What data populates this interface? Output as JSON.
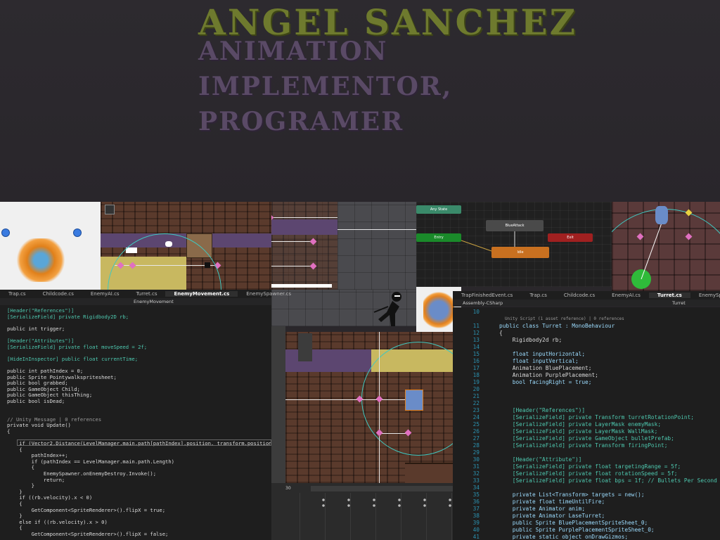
{
  "header": {
    "name": "ANGEL SANCHEZ",
    "role_line1": "ANIMATION",
    "role_line2": "IMPLEMENTOR,",
    "role_line3": "PROGRAMER"
  },
  "left_editor": {
    "tabs": [
      "Trap.cs",
      "Childcode.cs",
      "EnemyAI.cs",
      "Turret.cs",
      "EnemyMovement.cs",
      "EnemySpawner.cs"
    ],
    "active_tab": "EnemyMovement.cs",
    "breadcrumb": "EnemyMovement",
    "lines": [
      "[Header(\"References\")]",
      "[SerializeField] private Rigidbody2D rb;",
      "",
      "public int trigger;",
      "",
      "[Header(\"Attributes\")]",
      "[SerializeField] private float moveSpeed = 2f;",
      "",
      "[HideInInspector] public float currentTime;",
      "",
      "public int pathIndex = 0;",
      "public Sprite Pointywalkspritesheet;",
      "public bool grabbed;",
      "public GameObject Child;",
      "public GameObject thisThing;",
      "public bool isDead;",
      "",
      "",
      "// Unity Message | 0 references",
      "private void Update()",
      "{",
      "",
      "    if (Vector2.Distance(LevelManager.main.path[pathIndex].position, transform.position) <= 0.1f)",
      "    {",
      "        pathIndex++;",
      "        if (pathIndex == LevelManager.main.path.Length)",
      "        {",
      "            EnemySpawner.onEnemyDestroy.Invoke();",
      "            return;",
      "        }",
      "    }",
      "    if ((rb.velocity).x < 0)",
      "    {",
      "        GetComponent<SpriteRenderer>().flipX = true;",
      "    }",
      "    else if ((rb.velocity).x > 0)",
      "    {",
      "        GetComponent<SpriteRenderer>().flipX = false;"
    ]
  },
  "animator": {
    "any_state": "Any State",
    "entry": "Entry",
    "blue_attack": "BlueAttack",
    "idle": "Idle",
    "exit": "Exit"
  },
  "right_editor": {
    "tabs": [
      "TrapFinishedEvent.cs",
      "Trap.cs",
      "Childcode.cs",
      "EnemyAI.cs",
      "Turret.cs",
      "EnemySpawner.cs"
    ],
    "active_tab": "Turret.cs",
    "assembly": "Assembly-CSharp",
    "breadcrumb": "Turret",
    "codelens": "Unity Script (1 asset reference) | 0 references",
    "lines": [
      {
        "n": "10",
        "t": ""
      },
      {
        "n": "11",
        "t": "public class Turret : MonoBehaviour"
      },
      {
        "n": "12",
        "t": "{"
      },
      {
        "n": "13",
        "t": "    Rigidbody2d rb;"
      },
      {
        "n": "14",
        "t": ""
      },
      {
        "n": "15",
        "t": "    float inputHorizontal;"
      },
      {
        "n": "16",
        "t": "    float inputVertical;"
      },
      {
        "n": "17",
        "t": "    Animation BluePlacement;"
      },
      {
        "n": "18",
        "t": "    Animation PurplePlacement;"
      },
      {
        "n": "19",
        "t": "    bool facingRight = true;"
      },
      {
        "n": "20",
        "t": ""
      },
      {
        "n": "21",
        "t": ""
      },
      {
        "n": "22",
        "t": ""
      },
      {
        "n": "23",
        "t": "    [Header(\"References\")]"
      },
      {
        "n": "24",
        "t": "    [SerializeField] private Transform turretRotationPoint;"
      },
      {
        "n": "25",
        "t": "    [SerializeField] private LayerMask enemyMask;"
      },
      {
        "n": "26",
        "t": "    [SerializeField] private LayerMask WallMask;"
      },
      {
        "n": "27",
        "t": "    [SerializeField] private GameObject bulletPrefab;"
      },
      {
        "n": "28",
        "t": "    [SerializeField] private Transform firingPoint;"
      },
      {
        "n": "29",
        "t": ""
      },
      {
        "n": "30",
        "t": "    [Header(\"Attribute\")]"
      },
      {
        "n": "31",
        "t": "    [SerializeField] private float targetingRange = 5f;"
      },
      {
        "n": "32",
        "t": "    [SerializeField] private float rotationSpeed = 5f;"
      },
      {
        "n": "33",
        "t": "    [SerializeField] private float bps = 1f; // Bullets Per Second"
      },
      {
        "n": "34",
        "t": ""
      },
      {
        "n": "35",
        "t": "    private List<Transform> targets = new();"
      },
      {
        "n": "36",
        "t": "    private float timeUntilFire;"
      },
      {
        "n": "37",
        "t": "    private Animator anim;"
      },
      {
        "n": "38",
        "t": "    private Animator LaseTurret;"
      },
      {
        "n": "39",
        "t": "    public Sprite BluePlacementSpriteSheet_0;"
      },
      {
        "n": "40",
        "t": "    public Sprite PurplePlacementSpriteSheet_0;"
      },
      {
        "n": "41",
        "t": "    private static object onDrawGizmos;"
      }
    ]
  },
  "timeline": {
    "frame": "30"
  },
  "colors": {
    "name": "#6e7a2e",
    "role": "#5a4a66",
    "code_bg": "#1e1e1e"
  }
}
